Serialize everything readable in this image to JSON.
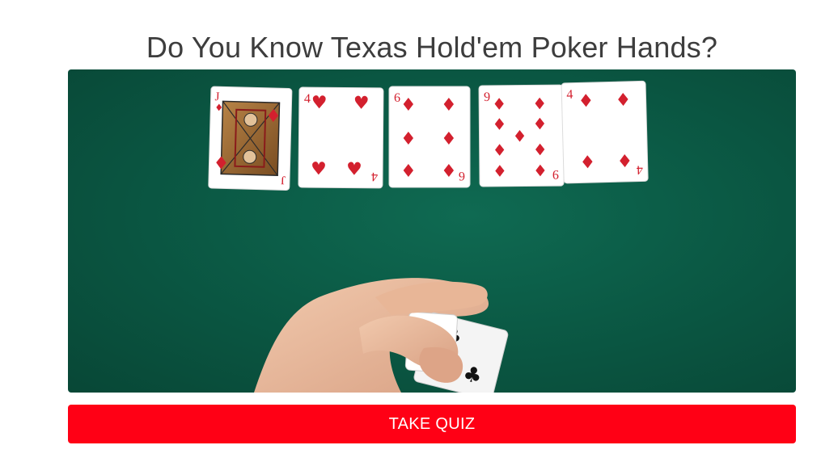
{
  "page": {
    "title": "Do You Know Texas Hold'em Poker Hands?"
  },
  "board_cards": [
    {
      "rank": "J",
      "suit": "diamonds",
      "suit_glyph": "♦"
    },
    {
      "rank": "4",
      "suit": "hearts",
      "suit_glyph": "♥"
    },
    {
      "rank": "6",
      "suit": "diamonds",
      "suit_glyph": "♦"
    },
    {
      "rank": "9",
      "suit": "diamonds",
      "suit_glyph": "♦"
    },
    {
      "rank": "4",
      "suit": "diamonds",
      "suit_glyph": "♦"
    }
  ],
  "hole_cards": [
    {
      "rank": "4",
      "suit": "spades",
      "suit_glyph": "♠"
    },
    {
      "rank": "4",
      "suit": "clubs",
      "suit_glyph": "♣"
    }
  ],
  "cta": {
    "label": "TAKE QUIZ",
    "color": "#ff0015"
  },
  "colors": {
    "felt": "#0b5a45",
    "red_suit": "#d3202e",
    "black_suit": "#111111"
  }
}
